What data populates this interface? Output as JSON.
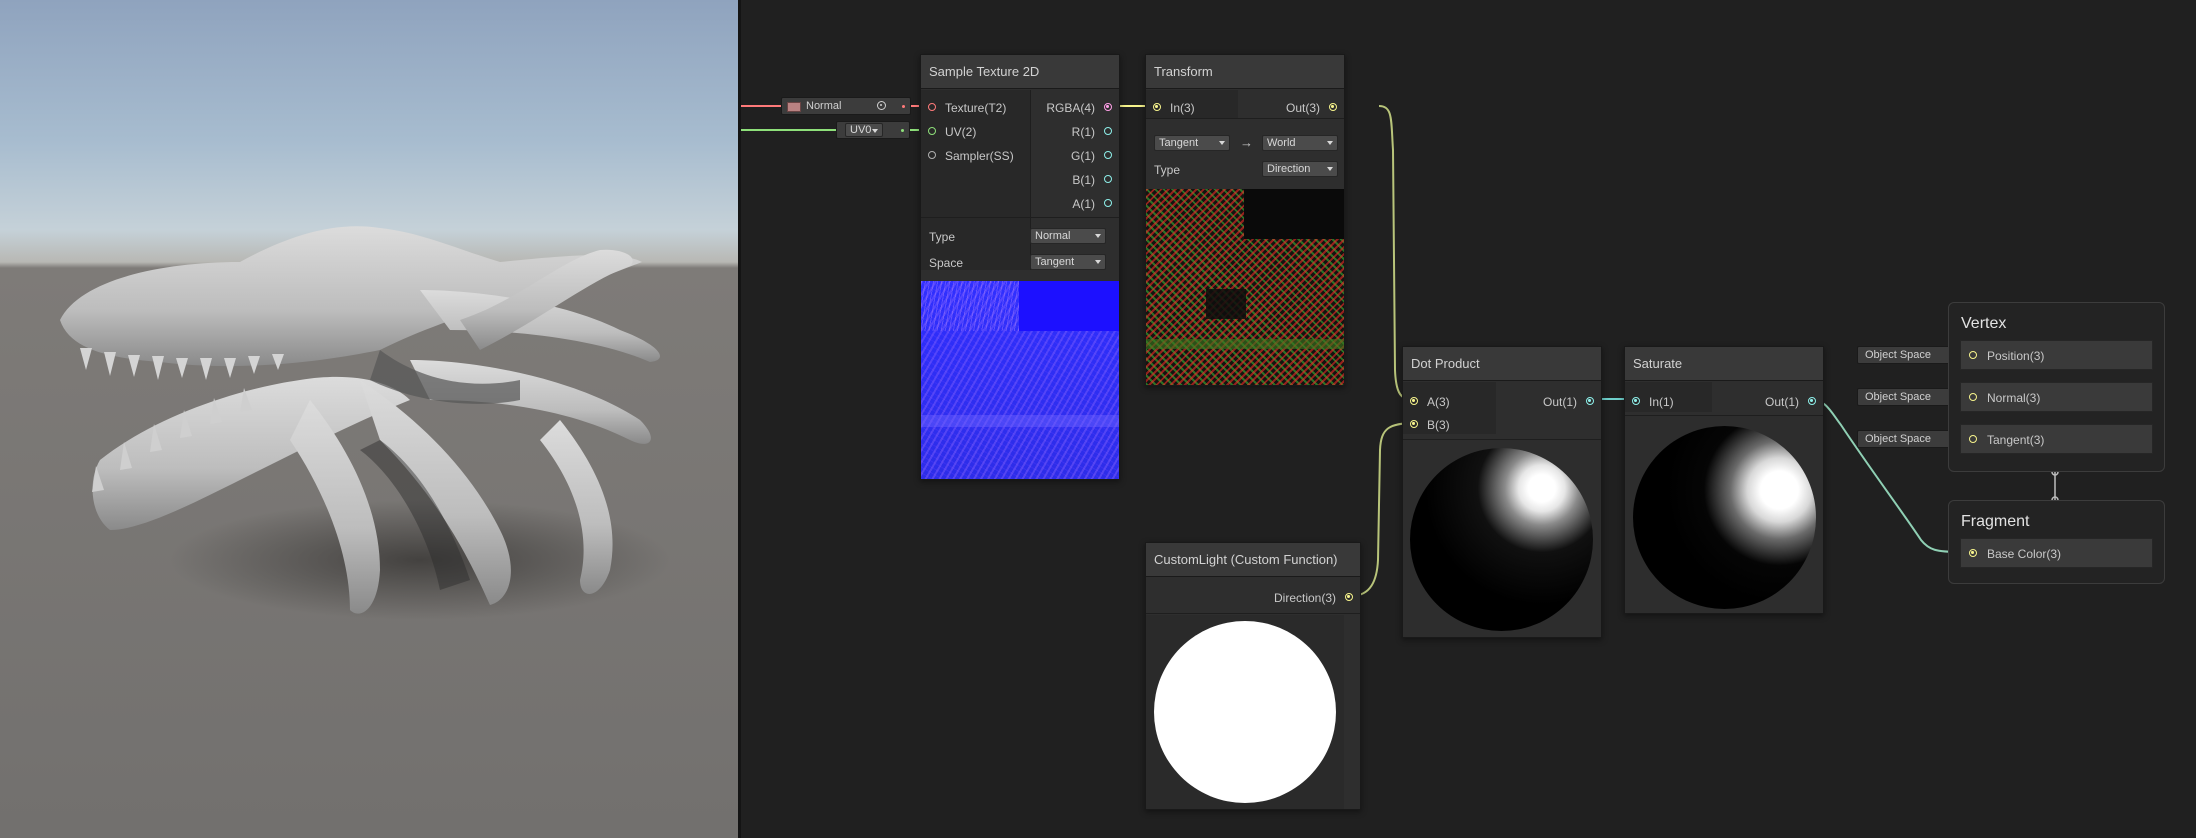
{
  "colors": {
    "texture": "#ff7a7a",
    "uv": "#8ee07a",
    "vector4": "#ff9fe7",
    "vector1": "#8ef0ea",
    "vector3": "#f7f48c"
  },
  "viewport": {
    "model": "skeleton-skull-model"
  },
  "inline_inputs": {
    "texture": {
      "label": "Normal",
      "icon": "target-icon"
    },
    "uv": {
      "value": "UV0"
    }
  },
  "nodes": {
    "sample_texture": {
      "title": "Sample Texture 2D",
      "inputs": [
        "Texture(T2)",
        "UV(2)",
        "Sampler(SS)"
      ],
      "outputs": [
        "RGBA(4)",
        "R(1)",
        "G(1)",
        "B(1)",
        "A(1)"
      ],
      "type_label": "Type",
      "type_value": "Normal",
      "space_label": "Space",
      "space_value": "Tangent"
    },
    "transform": {
      "title": "Transform",
      "input": "In(3)",
      "output": "Out(3)",
      "from_value": "Tangent",
      "arrow": "→",
      "to_value": "World",
      "type_label": "Type",
      "type_value": "Direction"
    },
    "custom_light": {
      "title": "CustomLight (Custom Function)",
      "output": "Direction(3)"
    },
    "dot_product": {
      "title": "Dot Product",
      "inputs": [
        "A(3)",
        "B(3)"
      ],
      "output": "Out(1)"
    },
    "saturate": {
      "title": "Saturate",
      "input": "In(1)",
      "output": "Out(1)"
    }
  },
  "master": {
    "vertex": {
      "title": "Vertex",
      "blocks": [
        "Position(3)",
        "Normal(3)",
        "Tangent(3)"
      ],
      "space_pills": [
        "Object Space",
        "Object Space",
        "Object Space"
      ]
    },
    "fragment": {
      "title": "Fragment",
      "blocks": [
        "Base Color(3)"
      ]
    }
  }
}
